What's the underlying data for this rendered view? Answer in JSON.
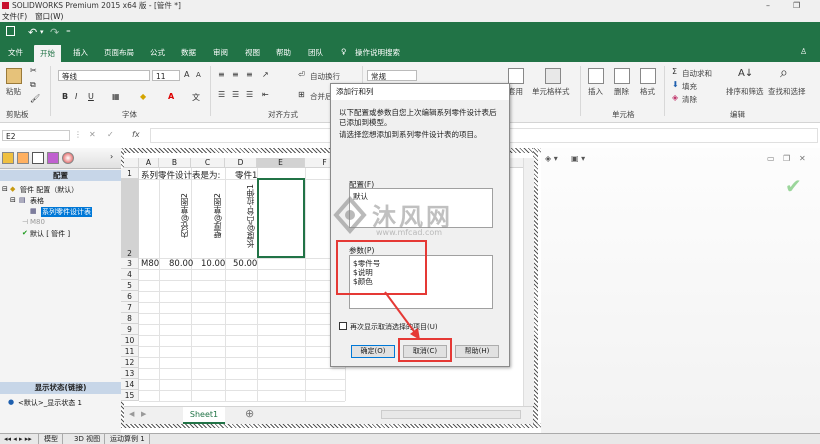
{
  "titlebar": {
    "title": "SOLIDWORKS Premium 2015 x64 版 - [管件 *]"
  },
  "menubar": {
    "items": [
      "文件(F)",
      "窗口(W)"
    ]
  },
  "ribbon_tabs": [
    "文件",
    "开始",
    "插入",
    "页面布局",
    "公式",
    "数据",
    "审阅",
    "视图",
    "帮助",
    "团队",
    "操作说明搜索"
  ],
  "ribbon": {
    "paste": "粘贴",
    "clipboard": "剪贴板",
    "font_name": "等线",
    "font_size": "11",
    "font_group": "字体",
    "wrap": "自动换行",
    "merge": "合并后",
    "align_group": "对齐方式",
    "number_format": "常规",
    "apply_style": "套用",
    "cell_style": "单元格样式",
    "insert": "插入",
    "delete": "删除",
    "format": "格式",
    "cells_group": "单元格",
    "autosum": "自动求和",
    "fill": "填充",
    "clear": "清除",
    "sort": "排序和筛选",
    "find": "查找和选择",
    "edit_group": "编辑"
  },
  "formula_bar": {
    "name_box": "E2",
    "fx": "fx"
  },
  "left_panel": {
    "header": "配置",
    "tree": [
      "管件 配置（默认）",
      "表格",
      "系列零件设计表",
      "M80",
      "默认 [ 管件 ]"
    ],
    "display_header": "显示状态(链接)",
    "display_item": "<默认>_显示状态 1"
  },
  "sheet": {
    "columns": [
      "A",
      "B",
      "C",
      "D",
      "E",
      "F"
    ],
    "rows": [
      "1",
      "2",
      "3",
      "4",
      "5",
      "6",
      "7",
      "8",
      "9",
      "10",
      "11",
      "12",
      "13",
      "14",
      "15"
    ],
    "r1_text": "系列零件设计表是为:",
    "r1_d": "零件1",
    "r2_b": "内径@草图2",
    "r2_c": "壁厚@草图2",
    "r2_d": "长度@凸台-拉伸1",
    "r3": [
      "M80",
      "80.00",
      "10.00",
      "50.00"
    ],
    "sheet_tab": "Sheet1",
    "add_sheet": "⊕"
  },
  "dialog": {
    "title": "添加行和列",
    "desc1": "以下配置或参数自您上次编辑系列零件设计表后已添加到模型。",
    "desc2": "请选择您想添加到系列零件设计表的项目。",
    "config_label": "配置(F)",
    "configs": [
      "默认"
    ],
    "params_label": "参数(P)",
    "params": [
      "$零件号",
      "$说明",
      "$颜色"
    ],
    "checkbox": "再次显示取消选择的项目(U)",
    "ok": "确定(O)",
    "cancel": "取消(C)",
    "help": "帮助(H)"
  },
  "status": {
    "tabs": [
      "模型",
      "3D 视图",
      "运动算例 1"
    ]
  },
  "watermark": {
    "brand": "沐风网",
    "url": "www.mfcad.com"
  },
  "colors": {
    "excel_green": "#217346",
    "highlight": "#e53935",
    "selection": "#0078d7"
  }
}
